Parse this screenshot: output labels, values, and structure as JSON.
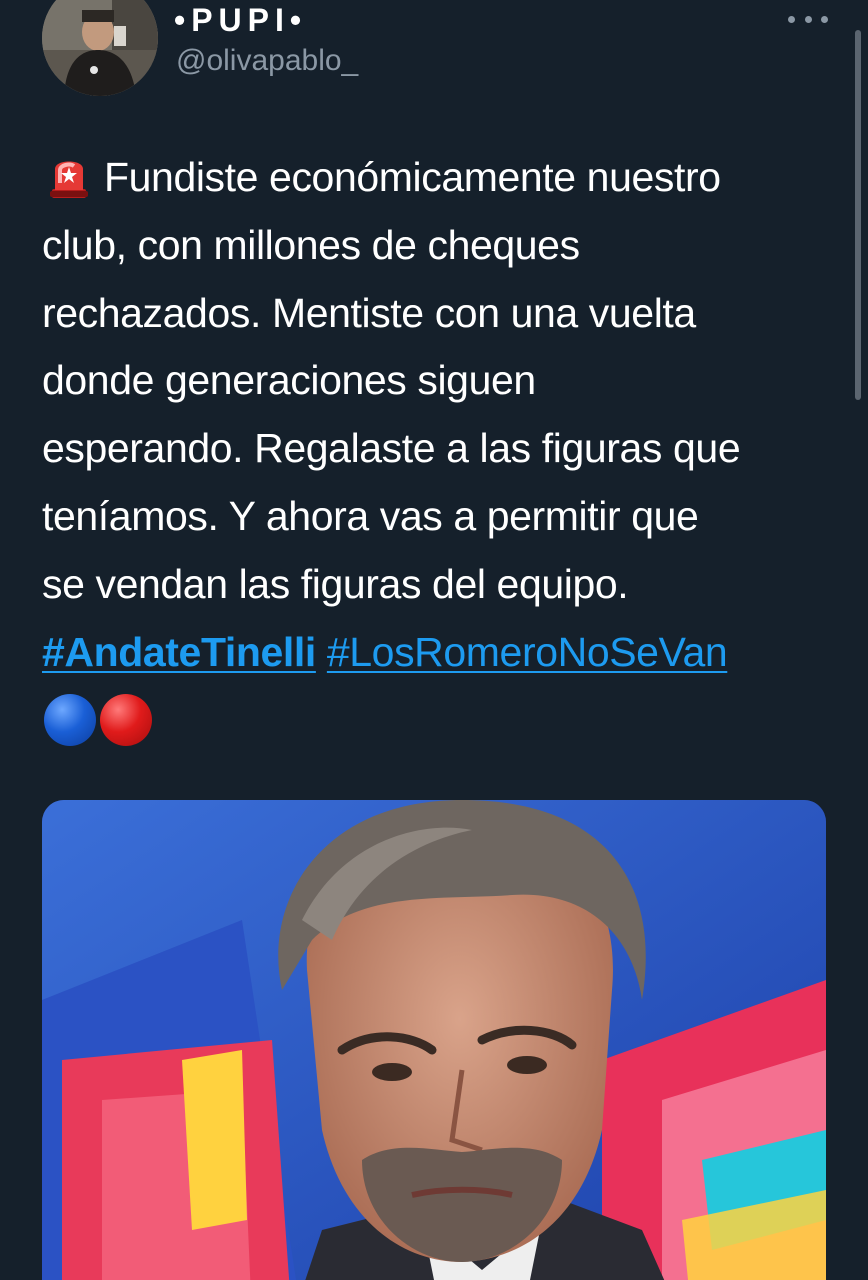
{
  "author": {
    "display_name": "•PUPI•",
    "handle": "@olivapablo_"
  },
  "tweet": {
    "text_lines": [
      "Fundiste económicamente nuestro",
      "club, con millones de cheques",
      "rechazados. Mentiste con una vuelta",
      "donde generaciones siguen",
      "esperando. Regalaste a las figuras que",
      "teníamos. Y ahora vas a permitir que",
      "se vendan las figuras del equipo."
    ],
    "hashtags": [
      "#AndateTinelli",
      "#LosRomeroNoSeVan"
    ],
    "leading_emoji": "siren-icon",
    "trailing_emojis": [
      "blue-circle-emoji",
      "red-circle-emoji"
    ]
  },
  "media": {
    "description_icon": "photo"
  },
  "icons": {
    "more": "more-horizontal-icon"
  },
  "colors": {
    "background": "#15202b",
    "text_primary": "#ffffff",
    "text_secondary": "#8b98a5",
    "link": "#1d9bf0"
  }
}
